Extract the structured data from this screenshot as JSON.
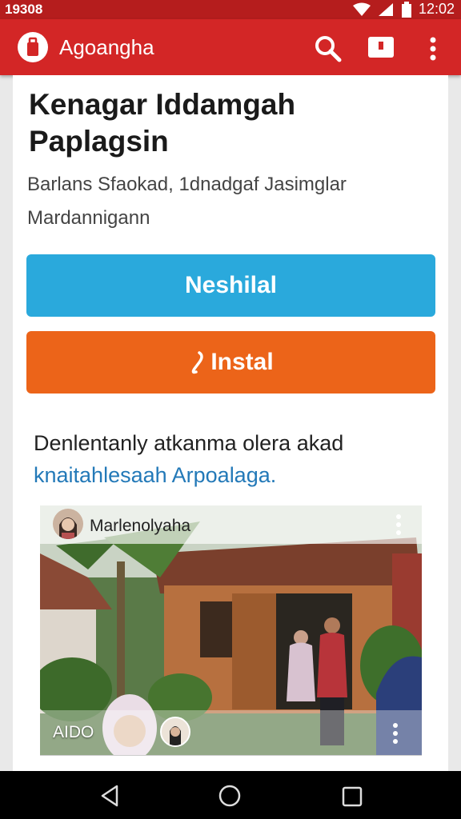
{
  "status_bar": {
    "time_left": "19308",
    "time_right": "12:02"
  },
  "app_bar": {
    "title": "Agoangha",
    "icons": [
      "app-logo-icon",
      "search-icon",
      "page-icon",
      "more-vert-icon"
    ]
  },
  "content": {
    "heading": "Kenagar Iddamgah Paplagsin",
    "subtitle": "Barlans Sfaokad, 1dnadgaf Jasimglar Mardannigann",
    "primary_button": "Neshilal",
    "install_button": "Instal",
    "description_text": "Denlentanly atkanma olera akad",
    "description_link": "knaitahlesaah Arpoalaga.",
    "post": {
      "author": "Marlenolyaha",
      "footer_label": "AIDO"
    }
  },
  "colors": {
    "status_bar": "#b51d1d",
    "app_bar": "#d32626",
    "primary_button": "#2aa9dc",
    "install_button": "#ec6419",
    "link": "#2379b8"
  }
}
